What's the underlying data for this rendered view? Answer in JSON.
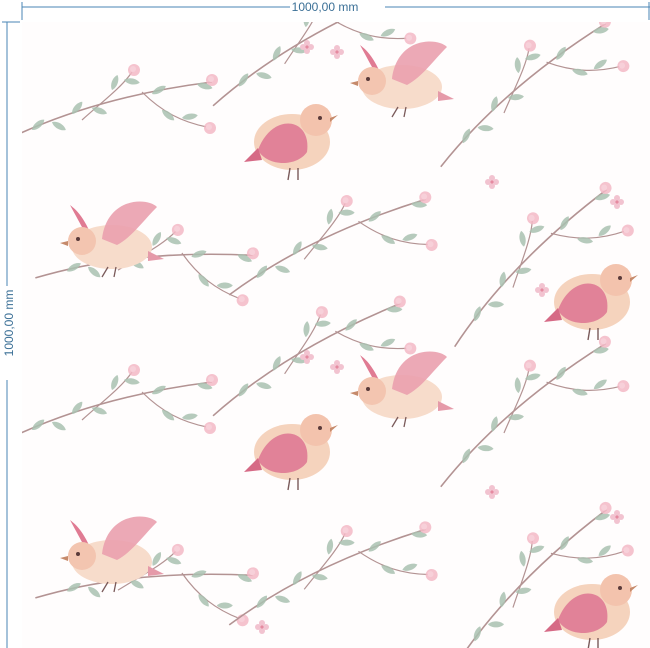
{
  "dimensions": {
    "width_label": "1000,00 mm",
    "height_label": "1000,00 mm",
    "line_color": "#4a86b4"
  },
  "pattern": {
    "description_colors": {
      "branch": "#b48c8c",
      "leaf": "#9fb7a6",
      "bud": "#f1b3c0",
      "bird_body": "#f6d6c2",
      "bird_wing": "#e37a94"
    },
    "icons": [
      "bird-icon",
      "branch-icon",
      "leaf-icon",
      "flower-icon"
    ]
  }
}
